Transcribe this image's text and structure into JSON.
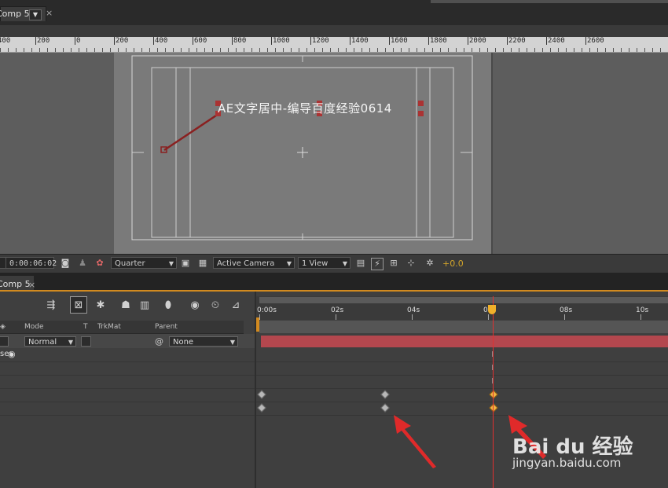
{
  "top_tab": {
    "label": "Comp 5",
    "dropdown": "▼",
    "close": "×"
  },
  "ruler_labels": [
    "400",
    "200",
    "0",
    "200",
    "400",
    "600",
    "800",
    "1000",
    "1200",
    "1400",
    "1600",
    "1800",
    "2000",
    "2200",
    "2400",
    "2600"
  ],
  "canvas_text": "AE文字居中-编导百度经验0614",
  "toolbar": {
    "timecode": "0:00:06:02",
    "resolution": "Quarter",
    "camera": "Active Camera",
    "views": "1 View",
    "exposure": "+0.0"
  },
  "timeline_tab": {
    "label": "Comp 5",
    "close": "×"
  },
  "columns": {
    "mode": "Mode",
    "t": "T",
    "trkmat": "TrkMat",
    "parent": "Parent"
  },
  "layer": {
    "mode": "Normal",
    "parent": "None"
  },
  "prop_label": "se:",
  "time_labels": [
    "0:00s",
    "02s",
    "04s",
    "06s",
    "08s",
    "10s"
  ],
  "watermark": {
    "brand": "Bai du 经验",
    "url": "jingyan.baidu.com"
  },
  "colors": {
    "playhead": "#e03030",
    "layer_bar": "#b4474e",
    "selected_keyframe": "#f2b544",
    "accent": "#d28a1f"
  }
}
